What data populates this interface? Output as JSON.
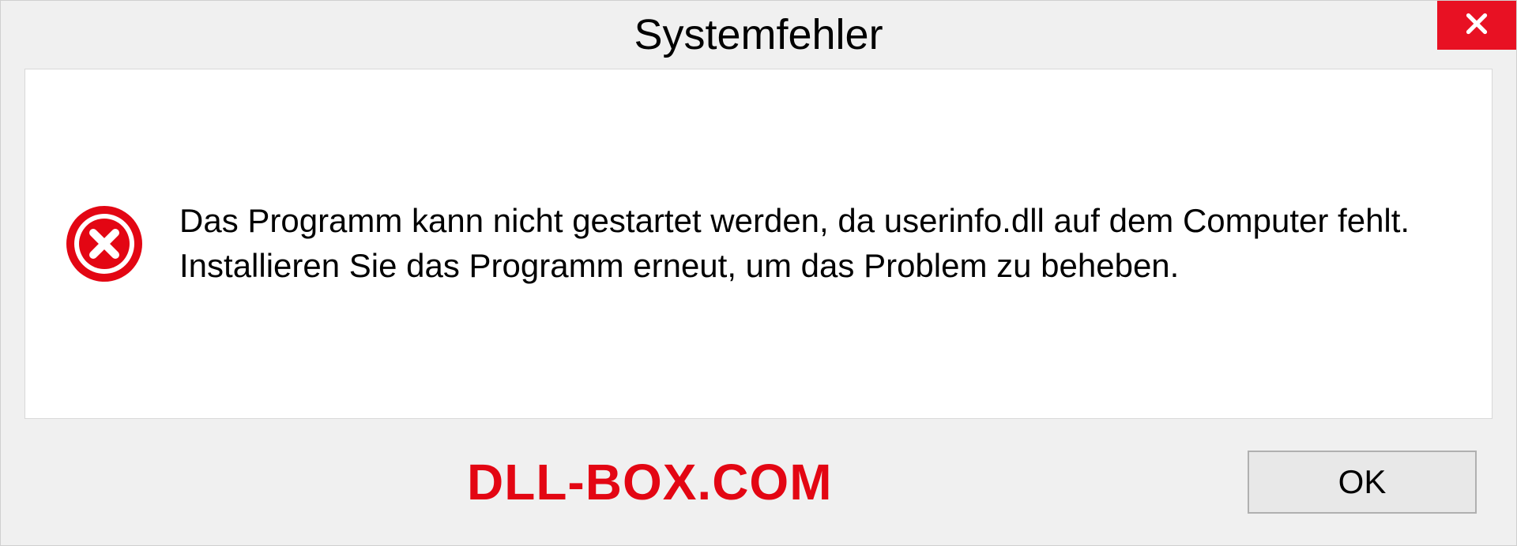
{
  "titlebar": {
    "title": "Systemfehler"
  },
  "content": {
    "message": "Das Programm kann nicht gestartet werden, da userinfo.dll auf dem Computer fehlt. Installieren Sie das Programm erneut, um das Problem zu beheben."
  },
  "footer": {
    "watermark": "DLL-BOX.COM",
    "ok_label": "OK"
  }
}
